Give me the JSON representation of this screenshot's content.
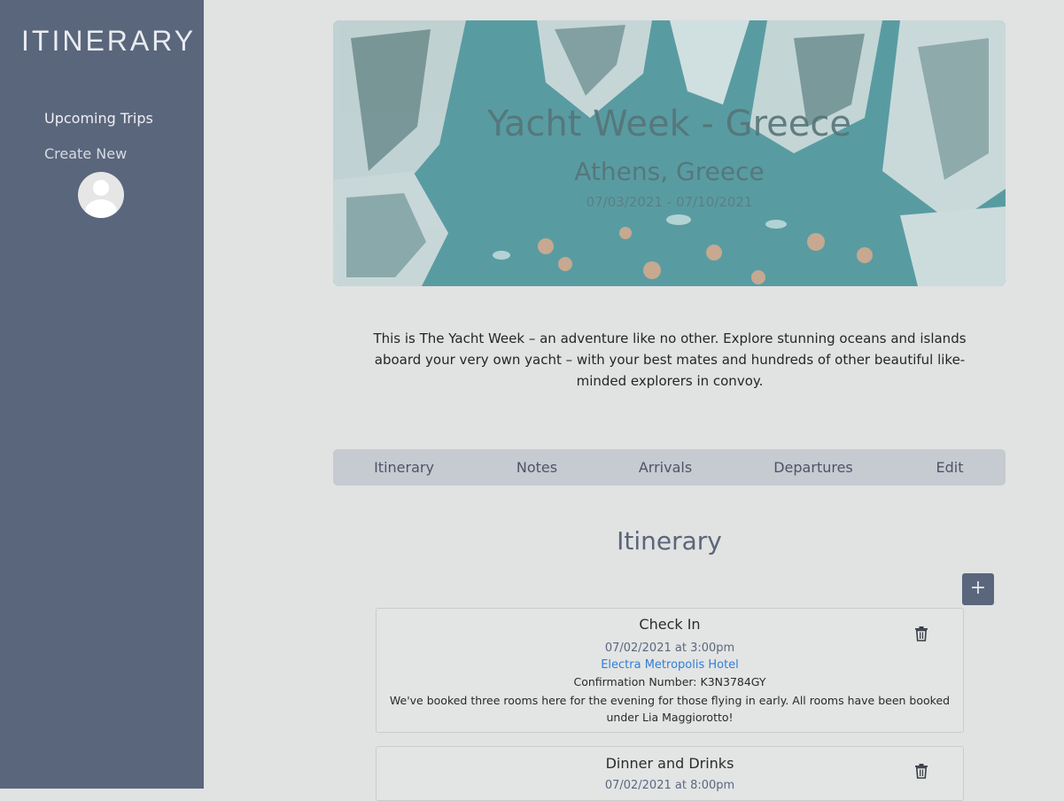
{
  "app": {
    "logo": "ITINERARY"
  },
  "sidebar": {
    "items": [
      {
        "label": "Upcoming Trips"
      },
      {
        "label": "Create New"
      }
    ]
  },
  "trip": {
    "title": "Yacht Week - Greece",
    "location": "Athens, Greece",
    "dates": "07/03/2021 - 07/10/2021",
    "description": "This is The Yacht Week – an adventure like no other. Explore stunning oceans and islands aboard your very own yacht – with your best mates and hundreds of other beautiful like-minded explorers in convoy."
  },
  "tabs": [
    {
      "label": "Itinerary"
    },
    {
      "label": "Notes"
    },
    {
      "label": "Arrivals"
    },
    {
      "label": "Departures"
    },
    {
      "label": "Edit"
    }
  ],
  "itinerary": {
    "title": "Itinerary",
    "add_label": "+",
    "events": [
      {
        "title": "Check In",
        "time": "07/02/2021 at 3:00pm",
        "location": "Electra Metropolis Hotel",
        "confirmation": "Confirmation Number: K3N3784GY",
        "notes": "We've booked three rooms here for the evening for those flying in early. All rooms have been booked under Lia Maggiorotto!"
      },
      {
        "title": "Dinner and Drinks",
        "time": "07/02/2021 at 8:00pm"
      }
    ]
  },
  "colors": {
    "sidebar": "#5a667c",
    "background": "#e1e2e2",
    "link": "#2f7fd8",
    "tabs_bg": "#c6cad1"
  }
}
